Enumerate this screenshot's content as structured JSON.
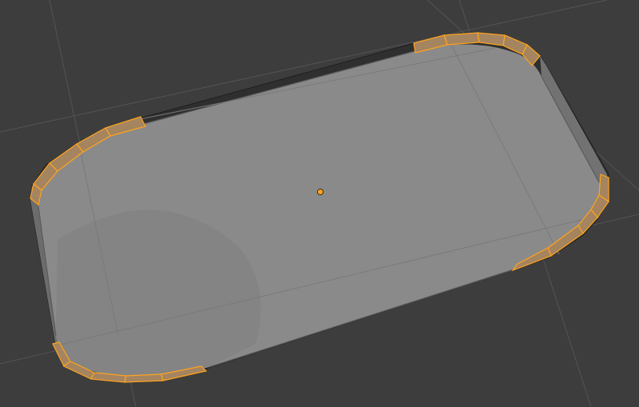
{
  "viewport": {
    "mode": "Edit Mode",
    "object": "rounded-rectangle-tray",
    "selection": "beveled-corner-faces",
    "colors": {
      "background": "#3d3d3d",
      "grid_line": "#545454",
      "rim_dark": "#2b2b2b",
      "rim_side": "#6e6e6e",
      "top_face": "#8a8a8a",
      "inner_edge": "#5c5c5c",
      "selected_edge": "#ffa41c",
      "selected_face": "#a58460",
      "origin": "#ffa41c"
    },
    "icons": {
      "origin": "object-origin-dot-icon"
    }
  }
}
